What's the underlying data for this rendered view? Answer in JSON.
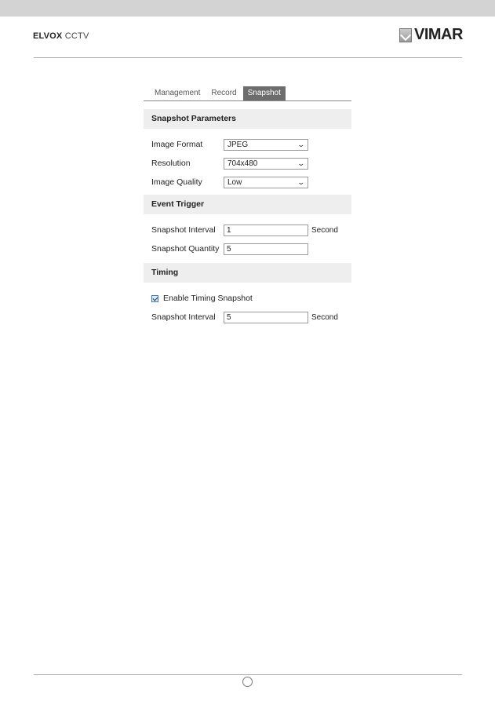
{
  "header": {
    "brand_bold": "ELVOX",
    "brand_light": "CCTV",
    "logo_text": "VIMAR"
  },
  "panel": {
    "tabs": [
      {
        "label": "Management",
        "active": false
      },
      {
        "label": "Record",
        "active": false
      },
      {
        "label": "Snapshot",
        "active": true
      }
    ],
    "snapshot_parameters": {
      "title": "Snapshot Parameters",
      "image_format": {
        "label": "Image Format",
        "value": "JPEG"
      },
      "resolution": {
        "label": "Resolution",
        "value": "704x480"
      },
      "image_quality": {
        "label": "Image Quality",
        "value": "Low"
      }
    },
    "event_trigger": {
      "title": "Event Trigger",
      "interval": {
        "label": "Snapshot Interval",
        "value": "1",
        "unit": "Second"
      },
      "quantity": {
        "label": "Snapshot Quantity",
        "value": "5"
      }
    },
    "timing": {
      "title": "Timing",
      "enable": {
        "label": "Enable Timing Snapshot",
        "checked": true
      },
      "interval": {
        "label": "Snapshot Interval",
        "value": "5",
        "unit": "Second"
      }
    }
  },
  "icons": {
    "chevron": "⌄"
  }
}
